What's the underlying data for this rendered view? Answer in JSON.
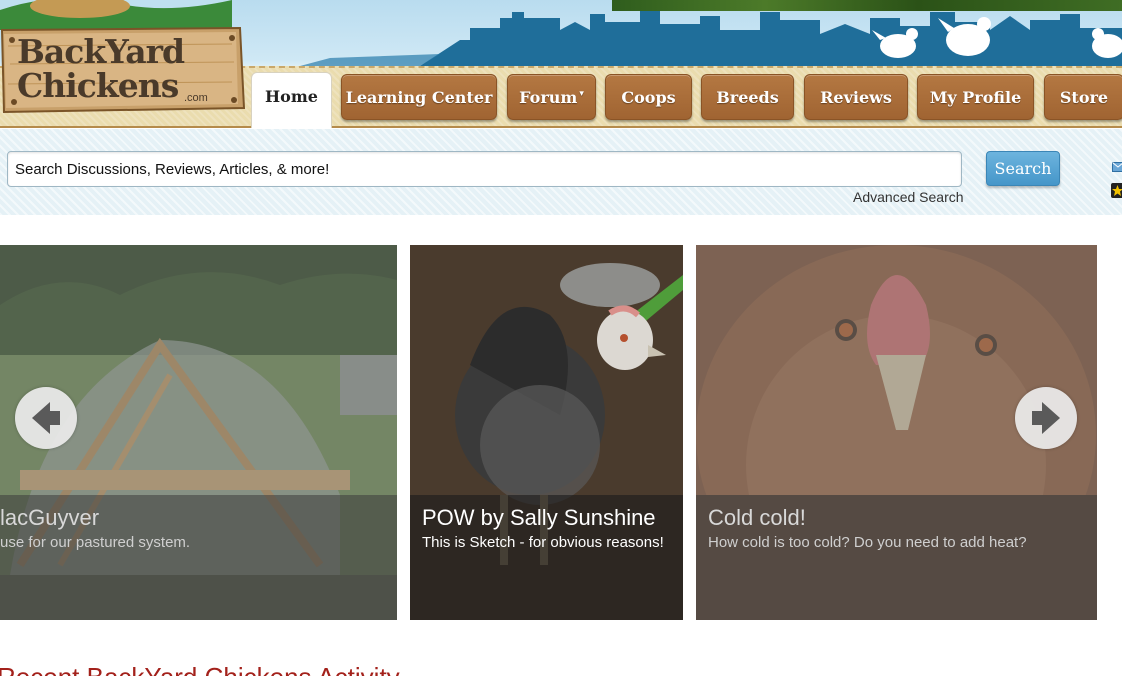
{
  "site": {
    "logo_line1": "BackYard",
    "logo_line2": "Chickens",
    "logo_suffix": ".com"
  },
  "nav": {
    "tabs": [
      {
        "label": "Home",
        "active": true
      },
      {
        "label": "Learning Center"
      },
      {
        "label": "Forum",
        "has_dropdown": true
      },
      {
        "label": "Coops"
      },
      {
        "label": "Breeds"
      },
      {
        "label": "Reviews"
      },
      {
        "label": "My Profile"
      },
      {
        "label": "Store"
      }
    ],
    "dropdown_caret": "▾"
  },
  "search": {
    "placeholder": "Search Discussions, Reviews, Articles, & more!",
    "button_label": "Search",
    "advanced_label": "Advanced Search"
  },
  "carousel": {
    "slides": [
      {
        "title": "lacGuyver",
        "text": "use for our pastured system."
      },
      {
        "title": "POW by Sally Sunshine",
        "text": "This is Sketch - for obvious reasons!"
      },
      {
        "title": "Cold cold!",
        "text": "How cold is too cold? Do you need to add heat?"
      }
    ]
  },
  "section": {
    "recent_heading": "Recent BackYard Chickens Activity"
  },
  "colors": {
    "nav_tab": "#a86b38",
    "search_button": "#4f9fd0",
    "heading": "#a3211b",
    "skyline": "#1f6e9a"
  }
}
